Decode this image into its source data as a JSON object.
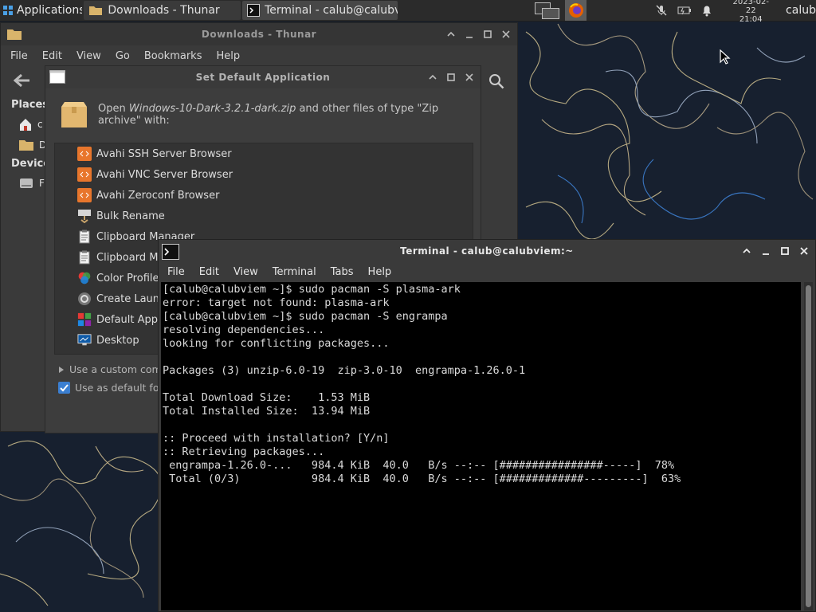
{
  "panel": {
    "apps_label": "Applications",
    "tasks": [
      {
        "label": "Downloads - Thunar"
      },
      {
        "label": "Terminal - calub@calubvi..."
      }
    ],
    "clock_date": "2023-02-22",
    "clock_time": "21:04",
    "user": "calub"
  },
  "thunar": {
    "title": "Downloads - Thunar",
    "menu": [
      "File",
      "Edit",
      "View",
      "Go",
      "Bookmarks",
      "Help"
    ],
    "places_header": "Places",
    "devices_header": "Device",
    "side_items": [
      "c",
      "D",
      "F"
    ]
  },
  "dialog": {
    "title": "Set Default Application",
    "prompt_prefix": "Open ",
    "prompt_file": "Windows-10-Dark-3.2.1-dark.zip",
    "prompt_suffix": " and other files of type \"Zip archive\" with:",
    "apps": [
      {
        "label": "Avahi SSH Server Browser",
        "icon": "avahi-icon"
      },
      {
        "label": "Avahi VNC Server Browser",
        "icon": "avahi-icon"
      },
      {
        "label": "Avahi Zeroconf Browser",
        "icon": "avahi-icon"
      },
      {
        "label": "Bulk Rename",
        "icon": "bulk-rename-icon"
      },
      {
        "label": "Clipboard Manager",
        "icon": "clipboard-icon"
      },
      {
        "label": "Clipboard Ma",
        "icon": "clipboard-icon"
      },
      {
        "label": "Color Profile",
        "icon": "color-profile-icon"
      },
      {
        "label": "Create Launc",
        "icon": "create-launcher-icon"
      },
      {
        "label": "Default Appl",
        "icon": "default-applications-icon"
      },
      {
        "label": "Desktop",
        "icon": "desktop-icon"
      }
    ],
    "custom_command_label": "Use a custom comm",
    "use_default_label": "Use as default for",
    "use_default_checked": true
  },
  "terminal": {
    "title": "Terminal - calub@calubviem:~",
    "menu": [
      "File",
      "Edit",
      "View",
      "Terminal",
      "Tabs",
      "Help"
    ],
    "lines": [
      "[calub@calubviem ~]$ sudo pacman -S plasma-ark",
      "error: target not found: plasma-ark",
      "[calub@calubviem ~]$ sudo pacman -S engrampa",
      "resolving dependencies...",
      "looking for conflicting packages...",
      "",
      "Packages (3) unzip-6.0-19  zip-3.0-10  engrampa-1.26.0-1",
      "",
      "Total Download Size:    1.53 MiB",
      "Total Installed Size:  13.94 MiB",
      "",
      ":: Proceed with installation? [Y/n]",
      ":: Retrieving packages...",
      " engrampa-1.26.0-...   984.4 KiB  40.0   B/s --:-- [################-----]  78%",
      " Total (0/3)           984.4 KiB  40.0   B/s --:-- [#############---------]  63%"
    ]
  },
  "colors": {
    "panel_bg": "#2b2b2b",
    "window_bg": "#3a3a3a",
    "terminal_bg": "#000000",
    "accent": "#3b7fd1",
    "wallpaper": "#17202f"
  }
}
